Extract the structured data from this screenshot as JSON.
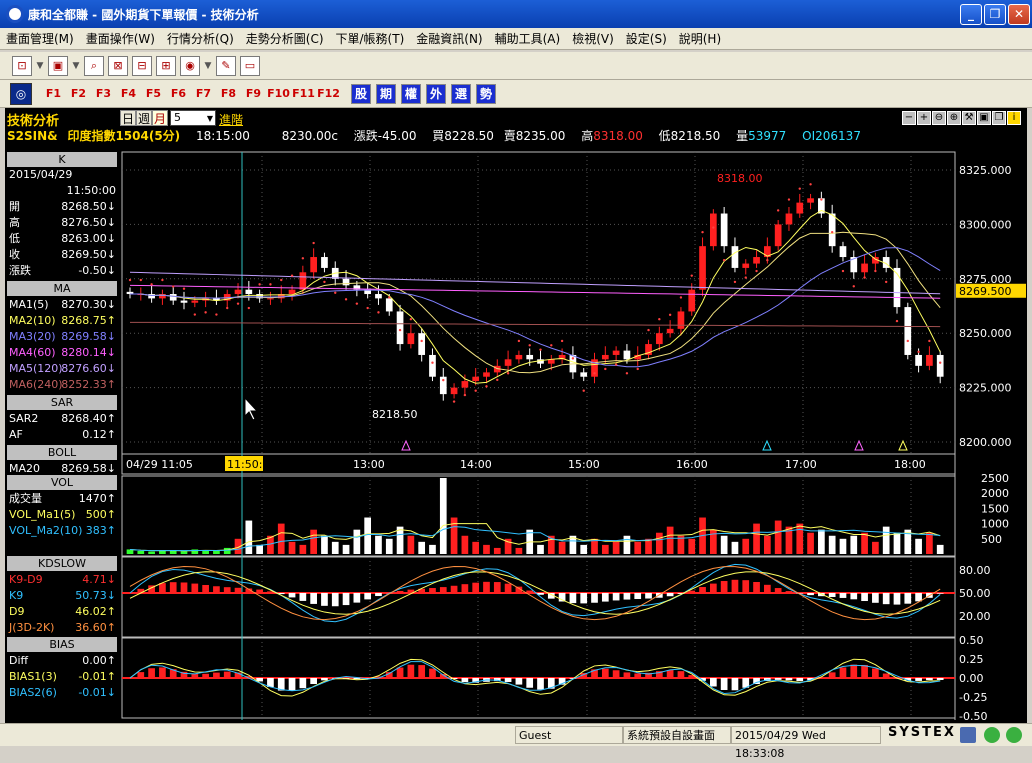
{
  "window": {
    "title": "康和全都賺 - 國外期貨下單報價 - 技術分析"
  },
  "menu": [
    "畫面管理(M)",
    "畫面操作(W)",
    "行情分析(Q)",
    "走勢分析圖(C)",
    "下單/帳務(T)",
    "金融資訊(N)",
    "輔助工具(A)",
    "檢視(V)",
    "設定(S)",
    "說明(H)"
  ],
  "toolbar2": {
    "fkeys": [
      "F1",
      "F2",
      "F3",
      "F4",
      "F5",
      "F6",
      "F7",
      "F8",
      "F9",
      "F10",
      "F11",
      "F12"
    ],
    "cat_buttons": [
      "股",
      "期",
      "權",
      "外",
      "選",
      "勢"
    ]
  },
  "panel": {
    "title": "技術分析",
    "periods": [
      "日",
      "週",
      "月",
      "分"
    ],
    "interval": "5",
    "go": "進階",
    "symbol": "S2SIN&",
    "name": "印度指數1504(5分)",
    "time": "18:15:00",
    "close": "8230.00c",
    "change": "漲跌-45.00",
    "bid": "買8228.50",
    "ask": "賣8235.00",
    "high_label": "高",
    "high_val": "8318.00",
    "low": "低8218.50",
    "vol_label": "量",
    "vol_val": "53977",
    "oi": "OI206137"
  },
  "left": {
    "k_head": "K",
    "date": "2015/04/29",
    "time": "11:50:00",
    "k_rows": [
      {
        "k": "開",
        "v": "8268.50↓"
      },
      {
        "k": "高",
        "v": "8276.50↓"
      },
      {
        "k": "低",
        "v": "8263.00↓"
      },
      {
        "k": "收",
        "v": "8269.50↓"
      },
      {
        "k": "漲跌",
        "v": "-0.50↓"
      }
    ],
    "ma_head": "MA",
    "ma_rows": [
      {
        "k": "MA1(5)",
        "v": "8270.30↓"
      },
      {
        "k": "MA2(10)",
        "v": "8268.75↑"
      },
      {
        "k": "MA3(20)",
        "v": "8269.58↓"
      },
      {
        "k": "MA4(60)",
        "v": "8280.14↓"
      },
      {
        "k": "MA5(120)",
        "v": "8276.60↓"
      },
      {
        "k": "MA6(240)",
        "v": "8252.33↑"
      }
    ],
    "sar_head": "SAR",
    "sar_rows": [
      {
        "k": "SAR2",
        "v": "8268.40↑"
      },
      {
        "k": "AF",
        "v": "0.12↑"
      }
    ],
    "boll_head": "BOLL",
    "boll_rows": [
      {
        "k": "MA20",
        "v": "8269.58↓"
      }
    ],
    "vol_head": "VOL",
    "vol_rows": [
      {
        "k": "成交量",
        "v": "1470↑"
      },
      {
        "k": "VOL_Ma1(5)",
        "v": "500↑"
      },
      {
        "k": "VOL_Ma2(10)",
        "v": "383↑"
      }
    ],
    "kd_head": "KDSLOW",
    "kd_rows": [
      {
        "k": "K9-D9",
        "v": "4.71↓"
      },
      {
        "k": "K9",
        "v": "50.73↓"
      },
      {
        "k": "D9",
        "v": "46.02↑"
      },
      {
        "k": "J(3D-2K)",
        "v": "36.60↑"
      }
    ],
    "bias_head": "BIAS",
    "bias_rows": [
      {
        "k": "Diff",
        "v": "0.00↑"
      },
      {
        "k": "BIAS1(3)",
        "v": "-0.01↑"
      },
      {
        "k": "BIAS2(6)",
        "v": "-0.01↓"
      }
    ]
  },
  "chart": {
    "price_ticks": [
      "8325.000",
      "8300.000",
      "8275.000",
      "8250.000",
      "8225.000",
      "8200.000"
    ],
    "price_cursor": "8269.500",
    "time_ticks": [
      "04/29 11:05",
      "11:50:00",
      "13:00",
      "14:00",
      "15:00",
      "16:00",
      "17:00",
      "18:00"
    ],
    "high_label": "8318.00",
    "low_label": "8218.50",
    "vol_ticks": [
      "2500",
      "2000",
      "1500",
      "1000",
      "500"
    ],
    "kd_ticks": [
      "80.00",
      "50.00",
      "20.00"
    ],
    "bias_ticks": [
      "0.50",
      "0.25",
      "0.00",
      "-0.25",
      "-0.50"
    ]
  },
  "colors": {
    "up": "#ff2020",
    "down": "#ffffff",
    "boll_upper": "#e01010",
    "boll_lower": "#ffffff",
    "sar": "#ff4040",
    "cursor": "#30c0c0"
  },
  "status": {
    "user": "Guest",
    "layout": "系統預設自設畫面",
    "datetime": "2015/04/29 Wed 18:33:08",
    "brand": "SYSTEX"
  }
}
